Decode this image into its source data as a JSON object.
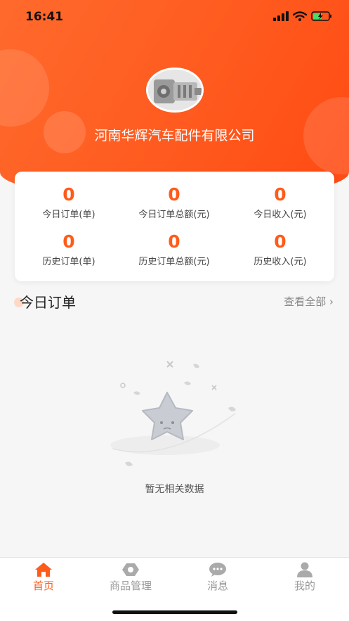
{
  "status_bar": {
    "time": "16:41"
  },
  "header": {
    "company_name": "河南华辉汽车配件有限公司"
  },
  "stats": [
    {
      "value": "0",
      "label": "今日订单(单)"
    },
    {
      "value": "0",
      "label": "今日订单总额(元)"
    },
    {
      "value": "0",
      "label": "今日收入(元)"
    },
    {
      "value": "0",
      "label": "历史订单(单)"
    },
    {
      "value": "0",
      "label": "历史订单总额(元)"
    },
    {
      "value": "0",
      "label": "历史收入(元)"
    }
  ],
  "today_orders": {
    "title": "今日订单",
    "view_all": "查看全部 ›",
    "empty_text": "暂无相关数据"
  },
  "tabbar": {
    "items": [
      {
        "label": "首页",
        "icon": "home-icon",
        "active": true
      },
      {
        "label": "商品管理",
        "icon": "product-icon",
        "active": false
      },
      {
        "label": "消息",
        "icon": "message-icon",
        "active": false
      },
      {
        "label": "我的",
        "icon": "user-icon",
        "active": false
      }
    ]
  },
  "colors": {
    "accent": "#ff5b1a",
    "background": "#f6f6f6"
  }
}
